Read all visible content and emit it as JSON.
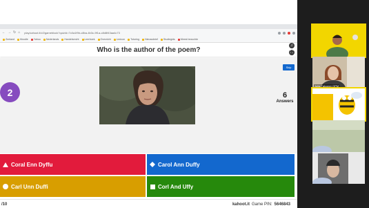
{
  "browser": {
    "url": "play.kahoot.it/v2/gameblock?quizId=7c0a1f9b-c8ba-4b3c-9f1a-c8d8f43aa4c73",
    "bookmarks": [
      "Zeeland",
      "Moodle",
      "Yahoo",
      "Nederlands",
      "Handelsrecht",
      "Leerboek",
      "Overzicht",
      "Lexicon",
      "Tutoring",
      "Nieuwsbrief",
      "Studiegids",
      "Meest bezochte"
    ]
  },
  "quiz": {
    "question": "Who is the author of the poem?",
    "timer": "2",
    "answer_count": "6",
    "answer_count_label": "Answers",
    "skip_label": "Skip",
    "answers": [
      {
        "label": "Coral Enn Dyffu",
        "color": "#e21b3c"
      },
      {
        "label": "Carol Ann Duffy",
        "color": "#1368ce"
      },
      {
        "label": "Carl Unn Duffi",
        "color": "#d89e00"
      },
      {
        "label": "Corl And Uffy",
        "color": "#26890c"
      }
    ],
    "progress": "/10",
    "site": "kahoot.it",
    "game_pin_label": "Game PIN:",
    "game_pin": "5646843"
  },
  "participants": [
    {
      "name": "",
      "bg": "#f2d600"
    },
    {
      "name": "Julia Falconer OPM",
      "bg": "#c7b49a"
    },
    {
      "name": "",
      "bg": "#f2d600"
    },
    {
      "name": "",
      "bg": "#b8c4a4"
    },
    {
      "name": "",
      "bg": "#9b9b9b"
    }
  ],
  "icons": [
    "back-icon",
    "forward-icon",
    "reload-icon",
    "home-icon",
    "triangle-icon",
    "diamond-icon",
    "circle-icon",
    "square-icon",
    "volume-icon",
    "fullscreen-icon"
  ]
}
